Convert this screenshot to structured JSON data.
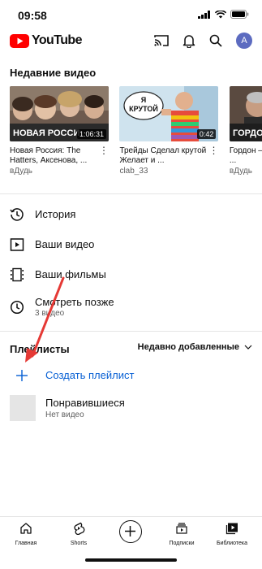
{
  "status_bar": {
    "time": "09:58"
  },
  "header": {
    "logo_text": "YouTube",
    "avatar_letter": "A"
  },
  "recent": {
    "title": "Недавние видео",
    "videos": [
      {
        "title": "Новая Россия: The Hatters, Аксенова, ...",
        "channel": "вДудь",
        "duration": "1:06:31",
        "overlay_text": "НОВАЯ РОССИ"
      },
      {
        "title": "Трейды Сделал крутой Желает и ...",
        "channel": "clab_33",
        "duration": "0:42",
        "overlay_text": "Я КРУТОЙ"
      },
      {
        "title": "Гордон – с ... Захаров ...",
        "channel": "вДудь",
        "duration": "",
        "overlay_text": "ГОРДОН"
      }
    ]
  },
  "library": {
    "history": {
      "label": "История"
    },
    "your_videos": {
      "label": "Ваши видео"
    },
    "your_movies": {
      "label": "Ваши фильмы"
    },
    "watch_later": {
      "label": "Смотреть позже",
      "sub": "3 видео"
    }
  },
  "playlists": {
    "title": "Плейлисты",
    "sort": "Недавно добавленные",
    "create_label": "Создать плейлист",
    "liked": {
      "title": "Понравившиеся",
      "sub": "Нет видео"
    }
  },
  "bottom_nav": {
    "home": "Главная",
    "shorts": "Shorts",
    "subscriptions": "Подписки",
    "library": "Библиотека"
  },
  "colors": {
    "brand_red": "#ff0000",
    "link_blue": "#065fd4",
    "arrow_red": "#e53935"
  }
}
